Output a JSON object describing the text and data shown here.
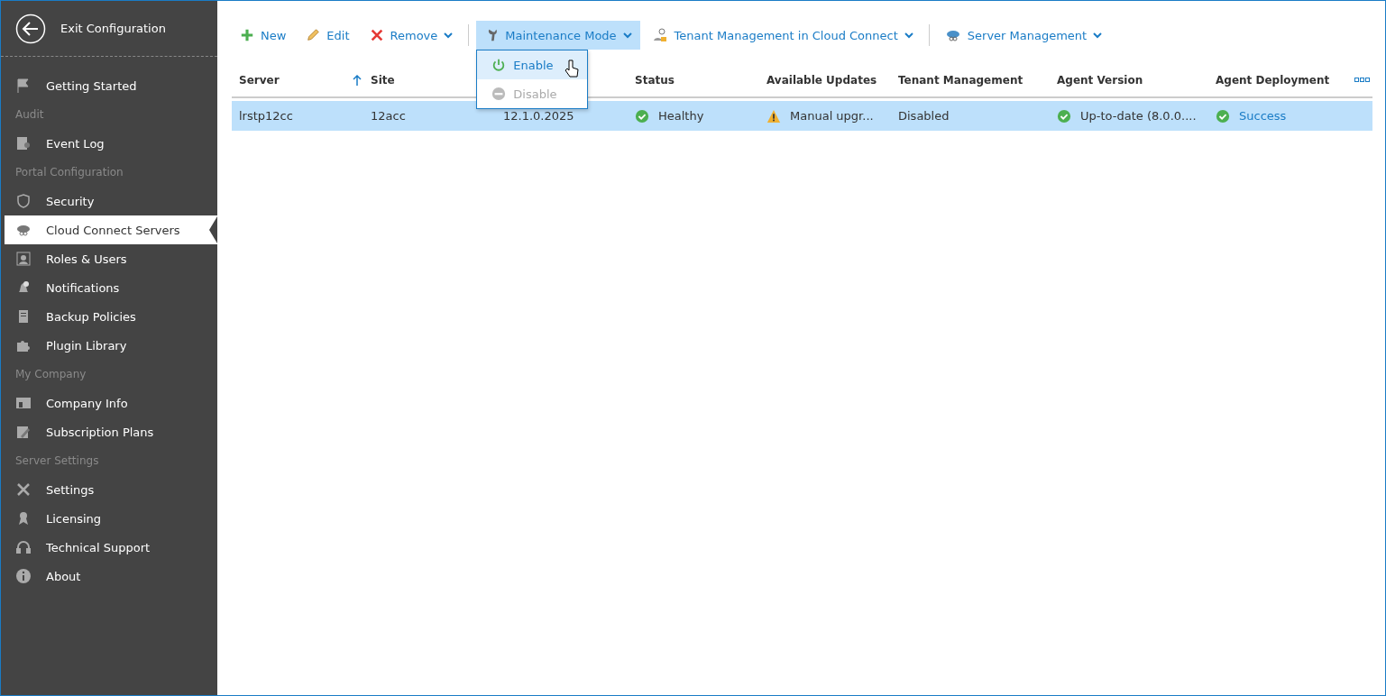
{
  "sidebar": {
    "exit": "Exit Configuration",
    "items": [
      {
        "kind": "item",
        "label": "Getting Started",
        "selected": false
      },
      {
        "kind": "section",
        "label": "Audit"
      },
      {
        "kind": "item",
        "label": "Event Log",
        "selected": false
      },
      {
        "kind": "section",
        "label": "Portal Configuration"
      },
      {
        "kind": "item",
        "label": "Security",
        "selected": false
      },
      {
        "kind": "item",
        "label": "Cloud Connect Servers",
        "selected": true
      },
      {
        "kind": "item",
        "label": "Roles & Users",
        "selected": false
      },
      {
        "kind": "item",
        "label": "Notifications",
        "selected": false
      },
      {
        "kind": "item",
        "label": "Backup Policies",
        "selected": false
      },
      {
        "kind": "item",
        "label": "Plugin Library",
        "selected": false
      },
      {
        "kind": "section",
        "label": "My Company"
      },
      {
        "kind": "item",
        "label": "Company Info",
        "selected": false
      },
      {
        "kind": "item",
        "label": "Subscription Plans",
        "selected": false
      },
      {
        "kind": "section",
        "label": "Server Settings"
      },
      {
        "kind": "item",
        "label": "Settings",
        "selected": false
      },
      {
        "kind": "item",
        "label": "Licensing",
        "selected": false
      },
      {
        "kind": "item",
        "label": "Technical Support",
        "selected": false
      },
      {
        "kind": "item",
        "label": "About",
        "selected": false
      }
    ]
  },
  "toolbar": [
    {
      "kind": "button",
      "label": "New",
      "dropdown": false,
      "selected": false
    },
    {
      "kind": "button",
      "label": "Edit",
      "dropdown": false,
      "selected": false
    },
    {
      "kind": "button",
      "label": "Remove",
      "dropdown": true,
      "selected": false
    },
    {
      "kind": "separator"
    },
    {
      "kind": "button",
      "label": "Maintenance Mode",
      "dropdown": true,
      "selected": true,
      "menu": [
        {
          "label": "Enable",
          "selected": true,
          "disabled": false
        },
        {
          "label": "Disable",
          "selected": false,
          "disabled": true
        }
      ]
    },
    {
      "kind": "button",
      "label": "Tenant Management in Cloud Connect",
      "dropdown": true,
      "selected": false
    },
    {
      "kind": "separator"
    },
    {
      "kind": "button",
      "label": "Server Management",
      "dropdown": true,
      "selected": false
    }
  ],
  "table": {
    "columns": [
      {
        "label": "Server",
        "sorted": true
      },
      {
        "label": "Site",
        "sorted": false
      },
      {
        "sorted": false
      },
      {
        "label": "Status",
        "sorted": false
      },
      {
        "label": "Available Updates",
        "sorted": false
      },
      {
        "label": "Tenant Management",
        "sorted": false
      },
      {
        "label": "Agent Version",
        "sorted": false
      },
      {
        "label": "Agent Deployment",
        "sorted": false
      }
    ],
    "rows": [
      {
        "selected": true,
        "cells": [
          {
            "text": "lrstp12cc",
            "kind": "plain"
          },
          {
            "text": "12acc",
            "kind": "plain"
          },
          {
            "text": "12.1.0.2025",
            "kind": "plain"
          },
          {
            "text": "Healthy",
            "kind": "ok"
          },
          {
            "text": "Manual upgr...",
            "kind": "warning"
          },
          {
            "text": "Disabled",
            "kind": "plain"
          },
          {
            "text": "Up-to-date (8.0.0....",
            "kind": "ok"
          },
          {
            "text": "Success",
            "kind": "oklink"
          }
        ]
      }
    ]
  }
}
